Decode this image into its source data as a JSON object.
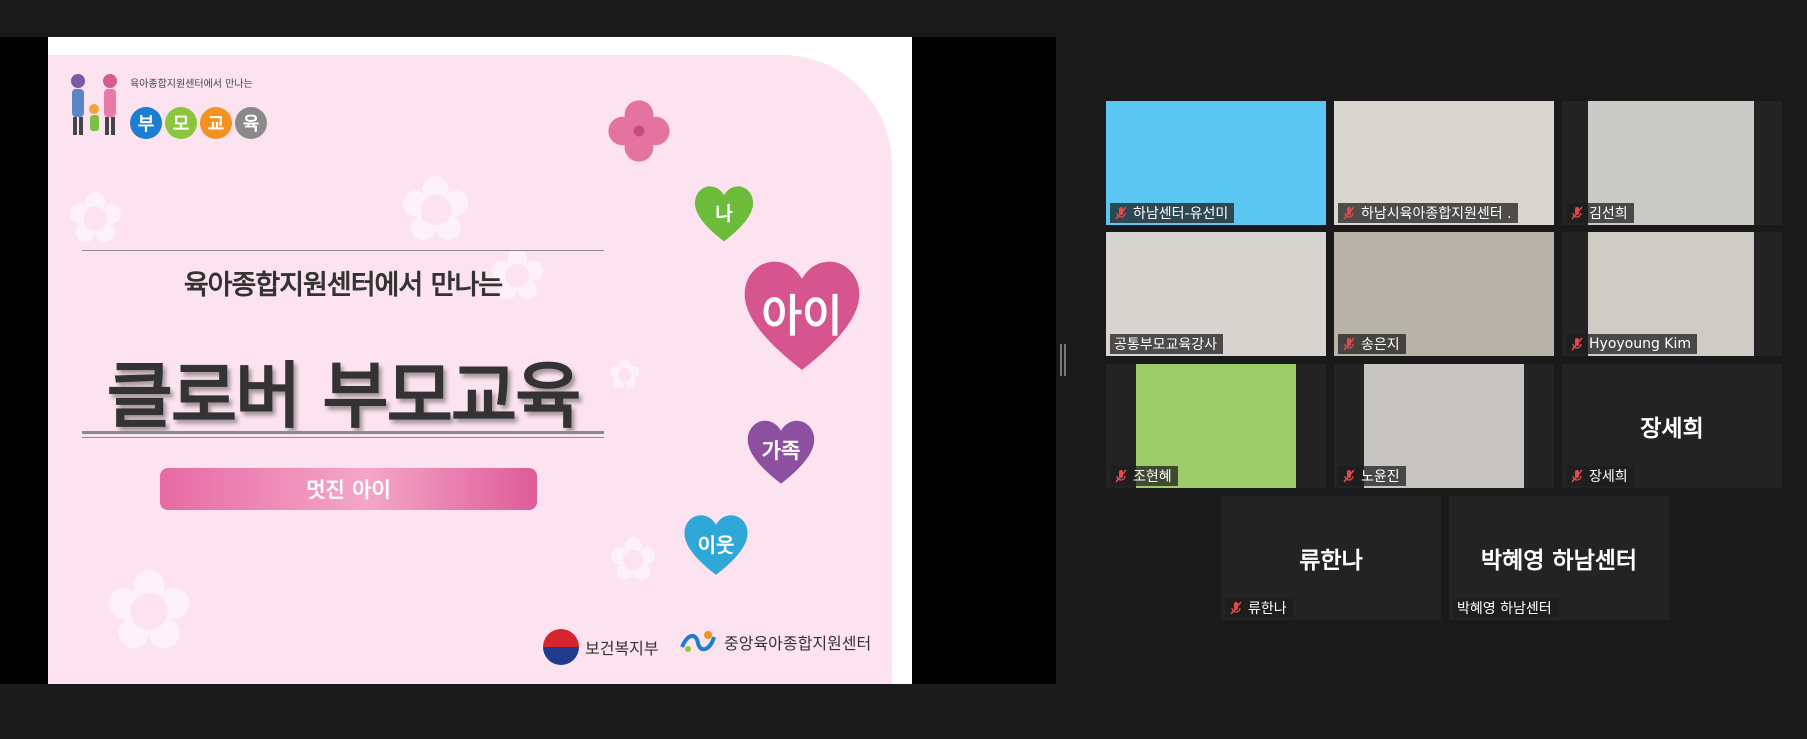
{
  "slide": {
    "logo_small": "육아종합지원센터에서 만나는",
    "logo_dots": [
      {
        "text": "부",
        "color": "#1a7fd0"
      },
      {
        "text": "모",
        "color": "#8cc63f"
      },
      {
        "text": "교",
        "color": "#f39121"
      },
      {
        "text": "육",
        "color": "#8a8a8a"
      }
    ],
    "subtitle": "육아종합지원센터에서 만나는",
    "title": "클로버 부모교육",
    "pink_bar": "멋진 아이",
    "hearts": {
      "na": {
        "text": "나",
        "color": "#6dbb3a"
      },
      "ai": {
        "text": "아이",
        "color": "#d7558f"
      },
      "gajok": {
        "text": "가족",
        "color": "#8d4fa0"
      },
      "iut": {
        "text": "이웃",
        "color": "#2fa8d8"
      }
    },
    "footer_left": "보건복지부",
    "footer_right": "중앙육아종합지원센터"
  },
  "participants": [
    {
      "name": "하남센터-유선미",
      "muted": true,
      "video": "#5bc6f2",
      "big": ""
    },
    {
      "name": "하남시육아종합지원센터 .",
      "muted": true,
      "video": "#d9d6cf",
      "big": ""
    },
    {
      "name": "김선희",
      "muted": true,
      "video": "#c9c9c6",
      "big": ""
    },
    {
      "name": "공통부모교육강사",
      "muted": false,
      "video": "#d8d4cf",
      "big": "",
      "active": true
    },
    {
      "name": "송은지",
      "muted": true,
      "video": "#b8b3a8",
      "big": ""
    },
    {
      "name": "Hyoyoung Kim",
      "muted": true,
      "video": "#cfccc5",
      "big": ""
    },
    {
      "name": "조현혜",
      "muted": true,
      "video": "#9ecb6a",
      "big": ""
    },
    {
      "name": "노윤진",
      "muted": true,
      "video": "#c7c5c1",
      "big": ""
    },
    {
      "name": "장세희",
      "muted": true,
      "video": "",
      "big": "장세희"
    },
    {
      "name": "류한나",
      "muted": true,
      "video": "",
      "big": "류한나"
    },
    {
      "name": "박혜영 하남센터",
      "muted": false,
      "video": "",
      "big": "박혜영 하남센터"
    }
  ]
}
